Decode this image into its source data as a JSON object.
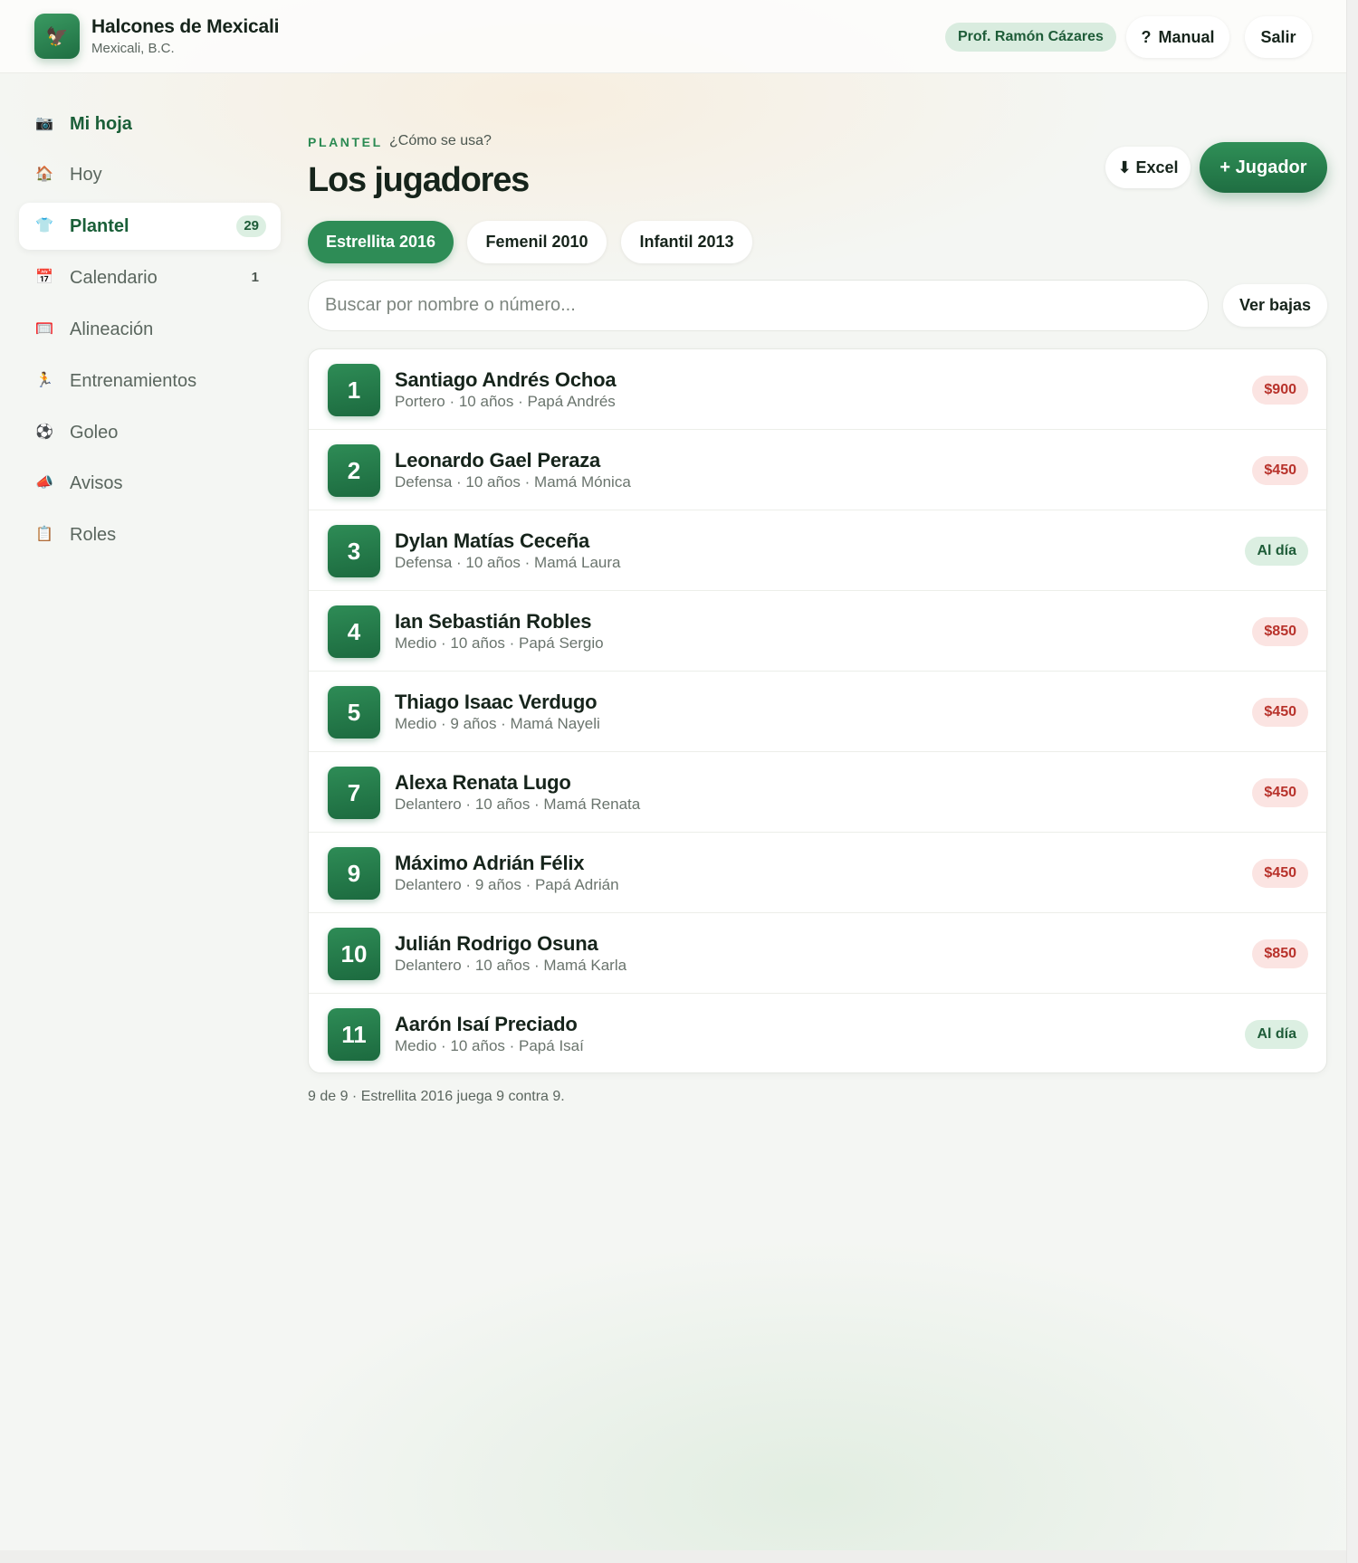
{
  "club": {
    "name": "Halcones de Mexicali",
    "city": "Mexicali, B.C.",
    "logo_icon": "falcon-icon"
  },
  "header": {
    "coach": "Prof. Ramón Cázares",
    "manual_label": "Manual",
    "manual_icon": "?",
    "logout_label": "Salir"
  },
  "sidebar": {
    "items": [
      {
        "label": "Mi hoja",
        "icon": "camera-icon",
        "glyph": "📷"
      },
      {
        "label": "Hoy",
        "icon": "house-icon",
        "glyph": "🏠"
      },
      {
        "label": "Plantel",
        "icon": "shirt-icon",
        "glyph": "👕",
        "badge": "29"
      },
      {
        "label": "Calendario",
        "icon": "calendar-icon",
        "glyph": "📅",
        "badge": "1"
      },
      {
        "label": "Alineación",
        "icon": "goal-icon",
        "glyph": "🥅"
      },
      {
        "label": "Entrenamientos",
        "icon": "runner-icon",
        "glyph": "🏃"
      },
      {
        "label": "Goleo",
        "icon": "ball-icon",
        "glyph": "⚽"
      },
      {
        "label": "Avisos",
        "icon": "megaphone-icon",
        "glyph": "📣"
      },
      {
        "label": "Roles",
        "icon": "roles-icon",
        "glyph": "📋"
      }
    ]
  },
  "main": {
    "eyebrow": "PLANTEL",
    "help_link": "¿Cómo se usa?",
    "title": "Los jugadores",
    "excel_label": "⬇ Excel",
    "add_label": "+ Jugador",
    "tabs": [
      {
        "label": "Estrellita 2016"
      },
      {
        "label": "Femenil 2010"
      },
      {
        "label": "Infantil 2013"
      }
    ],
    "search_placeholder": "Buscar por nombre o número...",
    "bajas_label": "Ver bajas",
    "players": [
      {
        "number": "1",
        "name": "Santiago Andrés Ochoa",
        "meta": "Portero · 10 años · Papá Andrés",
        "status": "$900"
      },
      {
        "number": "2",
        "name": "Leonardo Gael Peraza",
        "meta": "Defensa · 10 años · Mamá Mónica",
        "status": "$450"
      },
      {
        "number": "3",
        "name": "Dylan Matías Ceceña",
        "meta": "Defensa · 10 años · Mamá Laura",
        "status": "Al día"
      },
      {
        "number": "4",
        "name": "Ian Sebastián Robles",
        "meta": "Medio · 10 años · Papá Sergio",
        "status": "$850"
      },
      {
        "number": "5",
        "name": "Thiago Isaac Verdugo",
        "meta": "Medio · 9 años · Mamá Nayeli",
        "status": "$450"
      },
      {
        "number": "7",
        "name": "Alexa Renata Lugo",
        "meta": "Delantero · 10 años · Mamá Renata",
        "status": "$450"
      },
      {
        "number": "9",
        "name": "Máximo Adrián Félix",
        "meta": "Delantero · 9 años · Papá Adrián",
        "status": "$450"
      },
      {
        "number": "10",
        "name": "Julián Rodrigo Osuna",
        "meta": "Delantero · 10 años · Mamá Karla",
        "status": "$850"
      },
      {
        "number": "11",
        "name": "Aarón Isaí Preciado",
        "meta": "Medio · 10 años · Papá Isaí",
        "status": "Al día"
      }
    ],
    "footnote": "9 de 9 · Estrellita 2016 juega 9 contra 9."
  },
  "colors": {
    "brand": "#2e8c56",
    "debt": "#b8322b",
    "ok": "#1e5c38"
  }
}
